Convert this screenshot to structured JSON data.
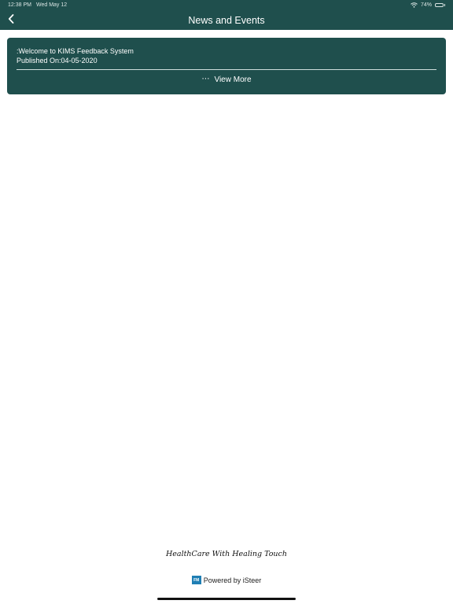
{
  "status_bar": {
    "time": "12:38 PM",
    "date": "Wed May 12",
    "battery_text": "74%",
    "battery_level_percent": 74
  },
  "nav": {
    "title": "News and Events",
    "back_icon": "chevron-left-icon"
  },
  "news": {
    "items": [
      {
        "title": ":Welcome to KIMS Feedback System",
        "published": "Published On:04-05-2020",
        "view_more_label": "View More",
        "more_icon": "ellipsis-icon"
      }
    ]
  },
  "footer": {
    "tagline": "HealthCare With Healing Touch",
    "powered_by": "Powered by iSteer",
    "logo_text": "FM"
  },
  "colors": {
    "brand": "#1f4f4d",
    "text_on_brand": "#ffffff",
    "logo_blue": "#1f7fb4",
    "battery_green": "#4cd964"
  }
}
